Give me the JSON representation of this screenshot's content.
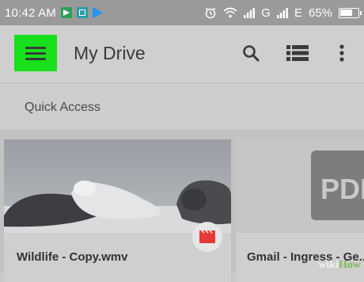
{
  "status_bar": {
    "time": "10:42 AM",
    "network_label": "G",
    "data_label": "E",
    "battery": "65%"
  },
  "app_bar": {
    "title": "My Drive",
    "icons": [
      "menu-icon",
      "search-icon",
      "list-view-icon",
      "more-vert-icon"
    ]
  },
  "quick_access": {
    "label": "Quick Access"
  },
  "cards": [
    {
      "name": "Wildlife - Copy.wmv",
      "badge_icon": "video-icon"
    },
    {
      "name": "Gmail - Ingress - Ge...",
      "thumb_label": "PDF"
    }
  ],
  "watermark": {
    "wiki": "wiki",
    "how": "How"
  },
  "colors": {
    "highlight": "#18e01c",
    "video_badge": "#e53935"
  }
}
